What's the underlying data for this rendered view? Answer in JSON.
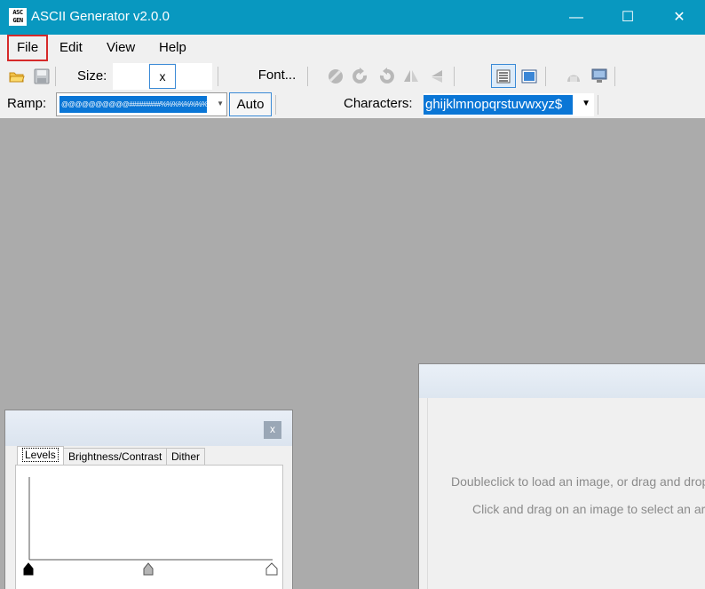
{
  "window": {
    "title": "ASCII Generator v2.0.0",
    "icon_text_top": "ASC",
    "icon_text_bottom": "GEN",
    "minimize_glyph": "—",
    "maximize_glyph": "☐",
    "close_glyph": "✕"
  },
  "menu": {
    "items": [
      "File",
      "Edit",
      "View",
      "Help"
    ],
    "selected": "File"
  },
  "toolbar": {
    "size_label": "Size:",
    "size_width": "",
    "size_separator": "x",
    "size_height": "",
    "font_label": "Font...",
    "icons": [
      "open-folder-icon",
      "save-icon",
      "black-text-icon",
      "rotate-cw-icon",
      "rotate-ccw-icon",
      "flip-vertical-icon",
      "flip-horizontal-icon",
      "text-mode-icon",
      "image-mode-icon",
      "fit-icon",
      "monitor-icon"
    ]
  },
  "ramp": {
    "label": "Ramp:",
    "value": "@@@@@@@@@@#########%%%%%%%%%%::::::::::..........",
    "auto_label": "Auto"
  },
  "characters": {
    "label": "Characters:",
    "value": "ghijklmnopqrstuvwxyz$"
  },
  "levels_window": {
    "close_label": "x",
    "tabs": [
      "Levels",
      "Brightness/Contrast",
      "Dither"
    ],
    "active_tab": "Levels",
    "levels": {
      "black": 0,
      "mid": 0.5,
      "white": 1
    }
  },
  "image_panel": {
    "hint_line1": "Doubleclick to load an image, or drag and drop",
    "hint_line2": "Click and drag on an image to select an are"
  },
  "colors": {
    "titlebar": "#0898c0",
    "selection": "#0a76d6",
    "workspace": "#ababab",
    "menu_highlight_border": "#d62a2a"
  }
}
